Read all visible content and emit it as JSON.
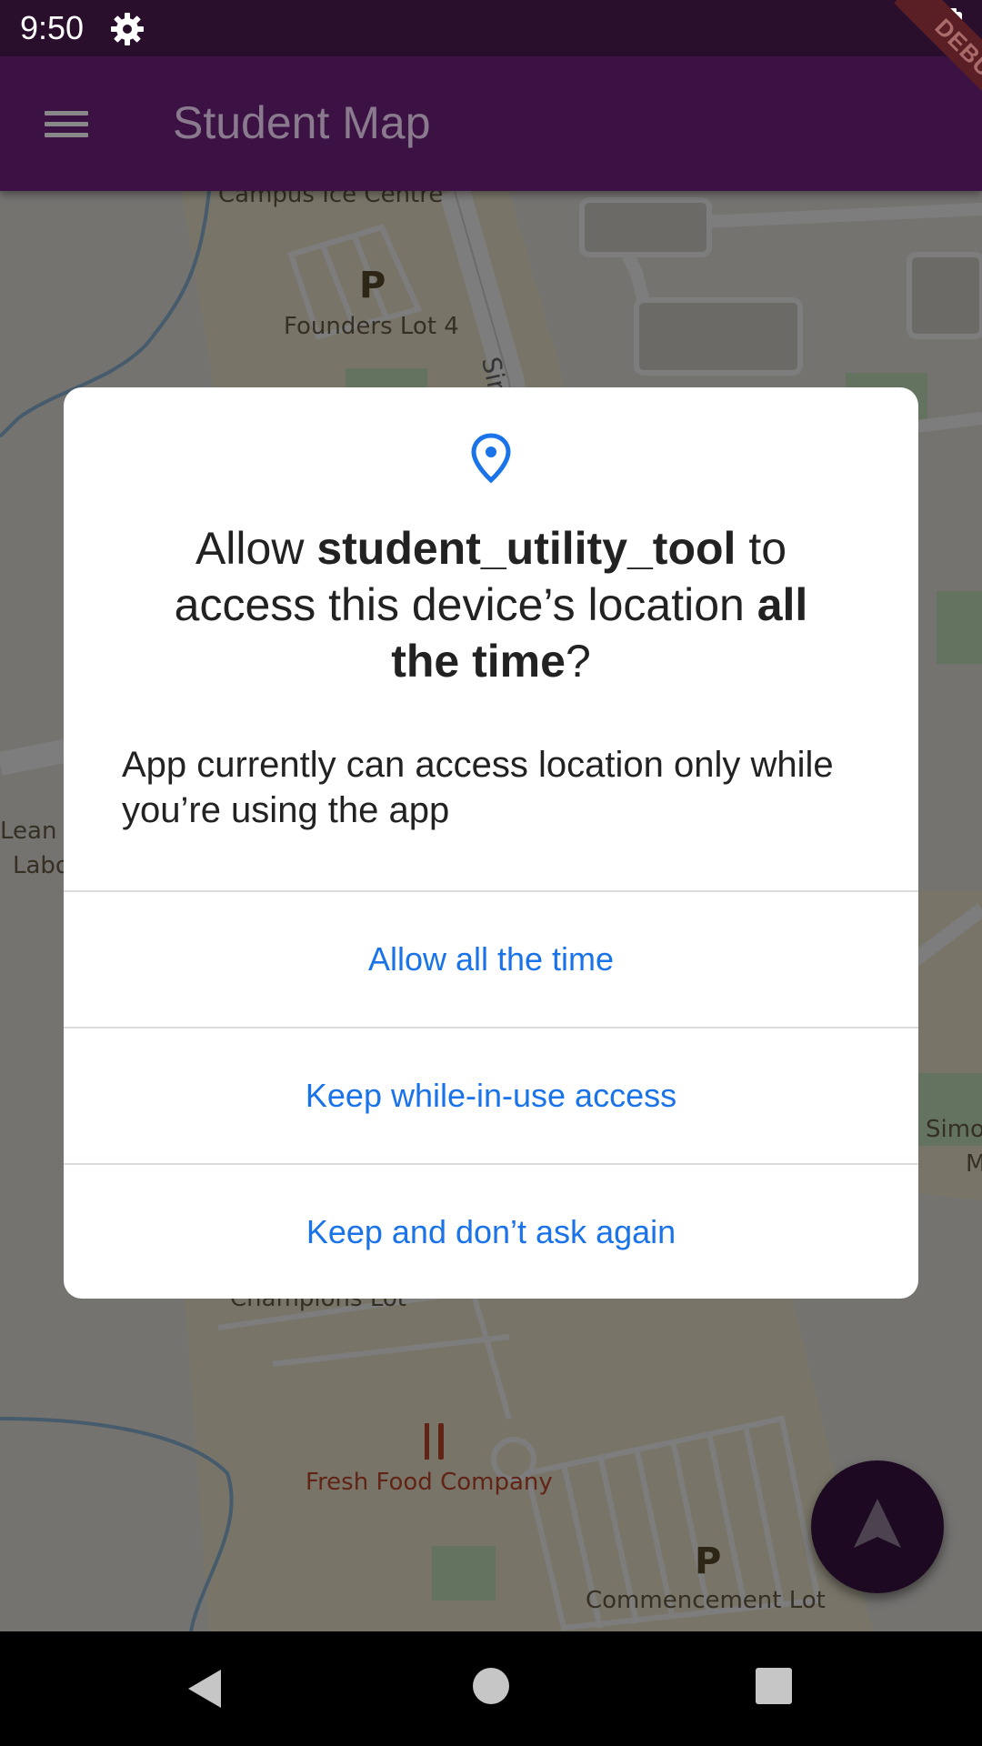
{
  "status_bar": {
    "time": "9:50",
    "icons": [
      "gear-icon",
      "battery-icon"
    ]
  },
  "app_bar": {
    "title": "Student Map",
    "menu_icon": "menu-icon",
    "debug_banner": "DEBUG"
  },
  "map": {
    "labels": {
      "campus_ice_centre": "Campus Ice Centre",
      "founders_lot_4": "Founders Lot 4",
      "parking_p": "P",
      "street_partial": "Sir",
      "champions_lot": "Champions Lot",
      "fresh_food_company": "Fresh Food Company",
      "commencement_lot": "Commencement Lot",
      "left_label_line1": "Lean E",
      "left_label_line2": "Labo",
      "right_label_line1": "Simo",
      "right_label_line2": "M"
    }
  },
  "dialog": {
    "icon": "location-pin-icon",
    "title": {
      "prefix": "Allow ",
      "app_name": "student_utility_tool",
      "middle": " to access this device’s location ",
      "emphasis": "all the time",
      "suffix": "?"
    },
    "message": "App currently can access location only while you’re using the app",
    "buttons": {
      "allow_all_time": "Allow all the time",
      "keep_while_in_use": "Keep while-in-use access",
      "keep_dont_ask": "Keep and don’t ask again"
    },
    "accent_color": "#1a73e8"
  },
  "fab": {
    "icon": "navigation-arrow-icon"
  },
  "nav_bar": {
    "icons": [
      "back-icon",
      "home-icon",
      "recents-icon"
    ]
  },
  "colors": {
    "app_bar": "#3c1244",
    "status_bar": "#2a0f2d"
  }
}
